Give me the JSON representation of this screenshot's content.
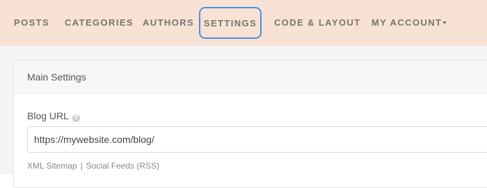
{
  "nav": {
    "posts": "POSTS",
    "categories": "CATEGORIES",
    "authors": "AUTHORS",
    "settings": "SETTINGS",
    "code_layout": "CODE & LAYOUT",
    "my_account": "MY ACCOUNT"
  },
  "colors": {
    "navbar_bg": "#f7e2d5",
    "highlight_border": "#4a90e2"
  },
  "panel": {
    "title": "Main Settings",
    "blog_url_label": "Blog URL",
    "help_icon_glyph": "?",
    "blog_url_value": "https://mywebsite.com/blog/",
    "links": {
      "sitemap": "XML Sitemap",
      "separator": "|",
      "feeds": "Social Feeds (RSS)"
    }
  }
}
